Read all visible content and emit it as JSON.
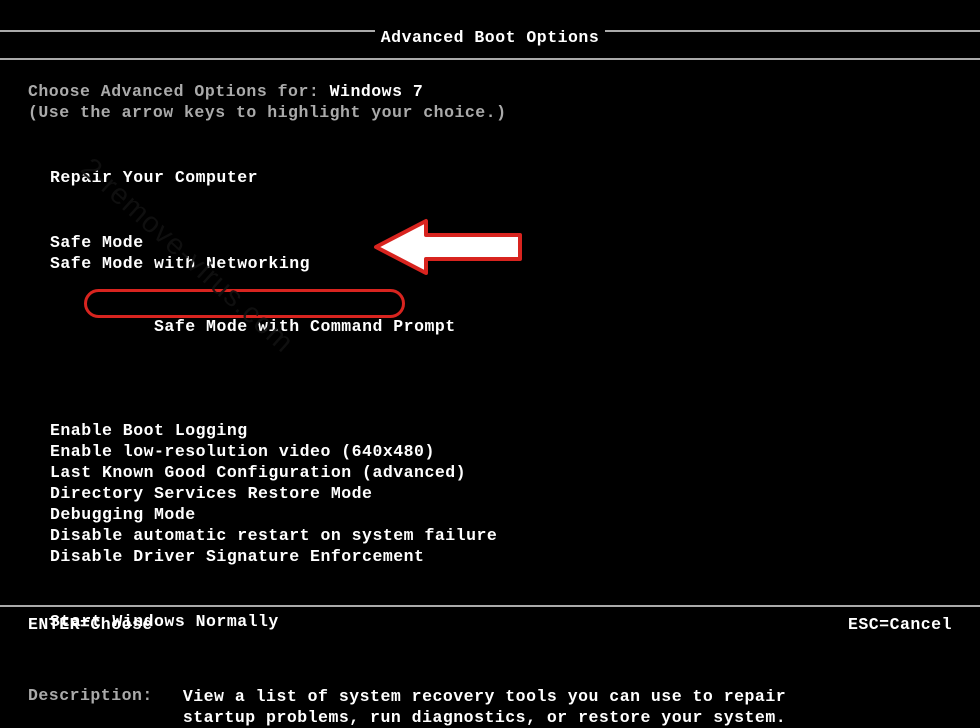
{
  "title": "Advanced Boot Options",
  "prompt_prefix": "Choose Advanced Options for: ",
  "os_name": "Windows 7",
  "hint": "(Use the arrow keys to highlight your choice.)",
  "repair": "Repair Your Computer",
  "options": {
    "safe": "Safe Mode",
    "safe_net": "Safe Mode with Networking",
    "safe_cmd": "Safe Mode with Command Prompt",
    "boot_log": "Enable Boot Logging",
    "low_res": "Enable low-resolution video (640x480)",
    "lkgc": "Last Known Good Configuration (advanced)",
    "dsrm": "Directory Services Restore Mode",
    "debug": "Debugging Mode",
    "no_restart": "Disable automatic restart on system failure",
    "no_sig": "Disable Driver Signature Enforcement",
    "normal": "Start Windows Normally"
  },
  "description": {
    "label": "Description:",
    "line1": "View a list of system recovery tools you can use to repair",
    "line2": "startup problems, run diagnostics, or restore your system."
  },
  "footer": {
    "enter": "ENTER=Choose",
    "esc": "ESC=Cancel"
  },
  "watermark": "2-remove-virus.com",
  "annotation": {
    "highlighted_option": "safe_cmd"
  }
}
